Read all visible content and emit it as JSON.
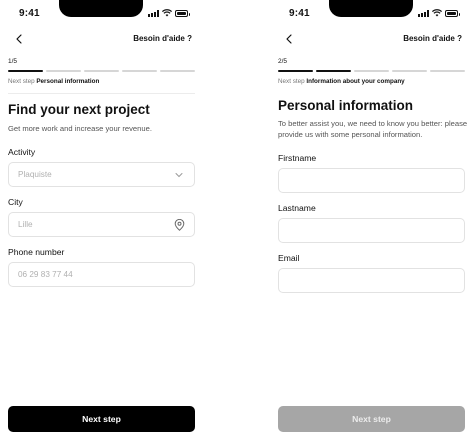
{
  "status": {
    "time": "9:41"
  },
  "screens": [
    {
      "help": "Besoin d'aide ?",
      "step": "1/5",
      "next_step_prefix": "Next step",
      "next_step_name": "Personal information",
      "progress": 0.2,
      "title": "Find your next project",
      "subtitle": "Get more work and increase your revenue.",
      "fields": [
        {
          "label": "Activity",
          "placeholder": "Plaquiste",
          "icon": "chevron-down-icon"
        },
        {
          "label": "City",
          "placeholder": "Lille",
          "icon": "location-pin-icon"
        },
        {
          "label": "Phone number",
          "placeholder": "06 29 83 77 44"
        }
      ],
      "button": "Next step"
    },
    {
      "help": "Besoin d'aide ?",
      "step": "2/5",
      "next_step_prefix": "Next step",
      "next_step_name": "Information about your company",
      "progress": 0.4,
      "title": "Personal information",
      "subtitle": "To better assist you, we need to know you better: please provide us with some personal information.",
      "fields": [
        {
          "label": "Firstname",
          "placeholder": ""
        },
        {
          "label": "Lastname",
          "placeholder": ""
        },
        {
          "label": "Email",
          "placeholder": ""
        }
      ],
      "button": "Next step"
    }
  ],
  "colors": {
    "primary": "#000000",
    "disabled": "#a6a6a6",
    "border": "#e2e2e2"
  }
}
